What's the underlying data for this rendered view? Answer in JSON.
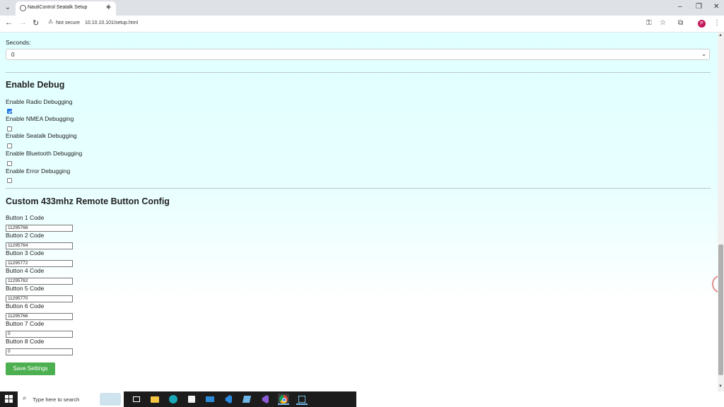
{
  "browser": {
    "tab_title": "NautiControl Seatalk Setup",
    "not_secure": "Not secure",
    "url": "10.10.10.101/setup.html",
    "profile_initial": "P"
  },
  "page": {
    "seconds_label": "Seconds:",
    "seconds_value": "0",
    "debug_heading": "Enable Debug",
    "debug_options": [
      {
        "label": "Enable Radio Debugging",
        "checked": true
      },
      {
        "label": "Enable NMEA Debugging",
        "checked": false
      },
      {
        "label": "Enable Seatalk Debugging",
        "checked": false
      },
      {
        "label": "Enable Bluetooth Debugging",
        "checked": false
      },
      {
        "label": "Enable Error Debugging",
        "checked": false
      }
    ],
    "remote_heading": "Custom 433mhz Remote Button Config",
    "buttons": [
      {
        "label": "Button 1 Code",
        "value": "11295768"
      },
      {
        "label": "Button 2 Code",
        "value": "11295764"
      },
      {
        "label": "Button 3 Code",
        "value": "11295772"
      },
      {
        "label": "Button 4 Code",
        "value": "11295762"
      },
      {
        "label": "Button 5 Code",
        "value": "11295770"
      },
      {
        "label": "Button 6 Code",
        "value": "11295766"
      },
      {
        "label": "Button 7 Code",
        "value": "0"
      },
      {
        "label": "Button 8 Code",
        "value": "0"
      }
    ],
    "save_label": "Save Settings"
  },
  "taskbar": {
    "search_placeholder": "Type here to search"
  },
  "colors": {
    "page_bg": "#e0ffff",
    "save_button": "#4caf50",
    "taskbar": "#1c1c1c"
  }
}
